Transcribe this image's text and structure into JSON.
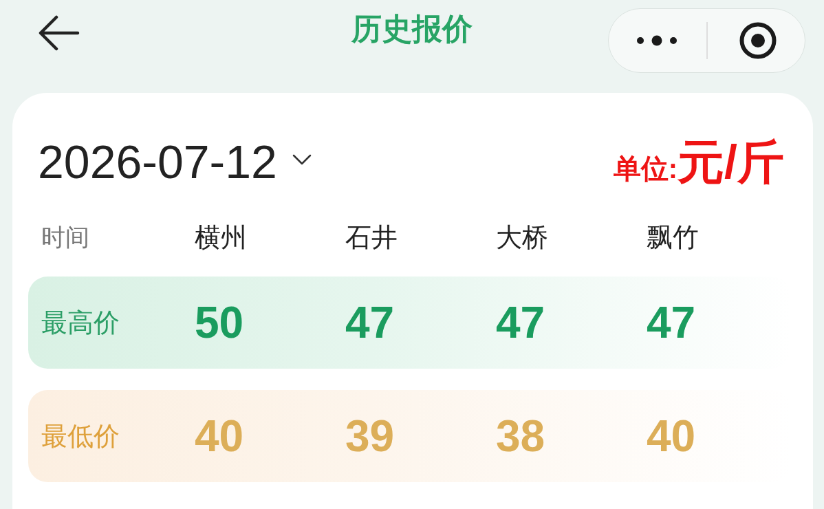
{
  "nav": {
    "title": "历史报价"
  },
  "date_picker": {
    "value": "2026-07-12"
  },
  "unit": {
    "label": "单位:",
    "value": "元/斤"
  },
  "table": {
    "columns": [
      "时间",
      "横州",
      "石井",
      "大桥",
      "飘竹"
    ],
    "rows": [
      {
        "kind": "high",
        "label": "最高价",
        "values": [
          "50",
          "47",
          "47",
          "47"
        ]
      },
      {
        "kind": "low",
        "label": "最低价",
        "values": [
          "40",
          "39",
          "38",
          "40"
        ]
      }
    ]
  }
}
